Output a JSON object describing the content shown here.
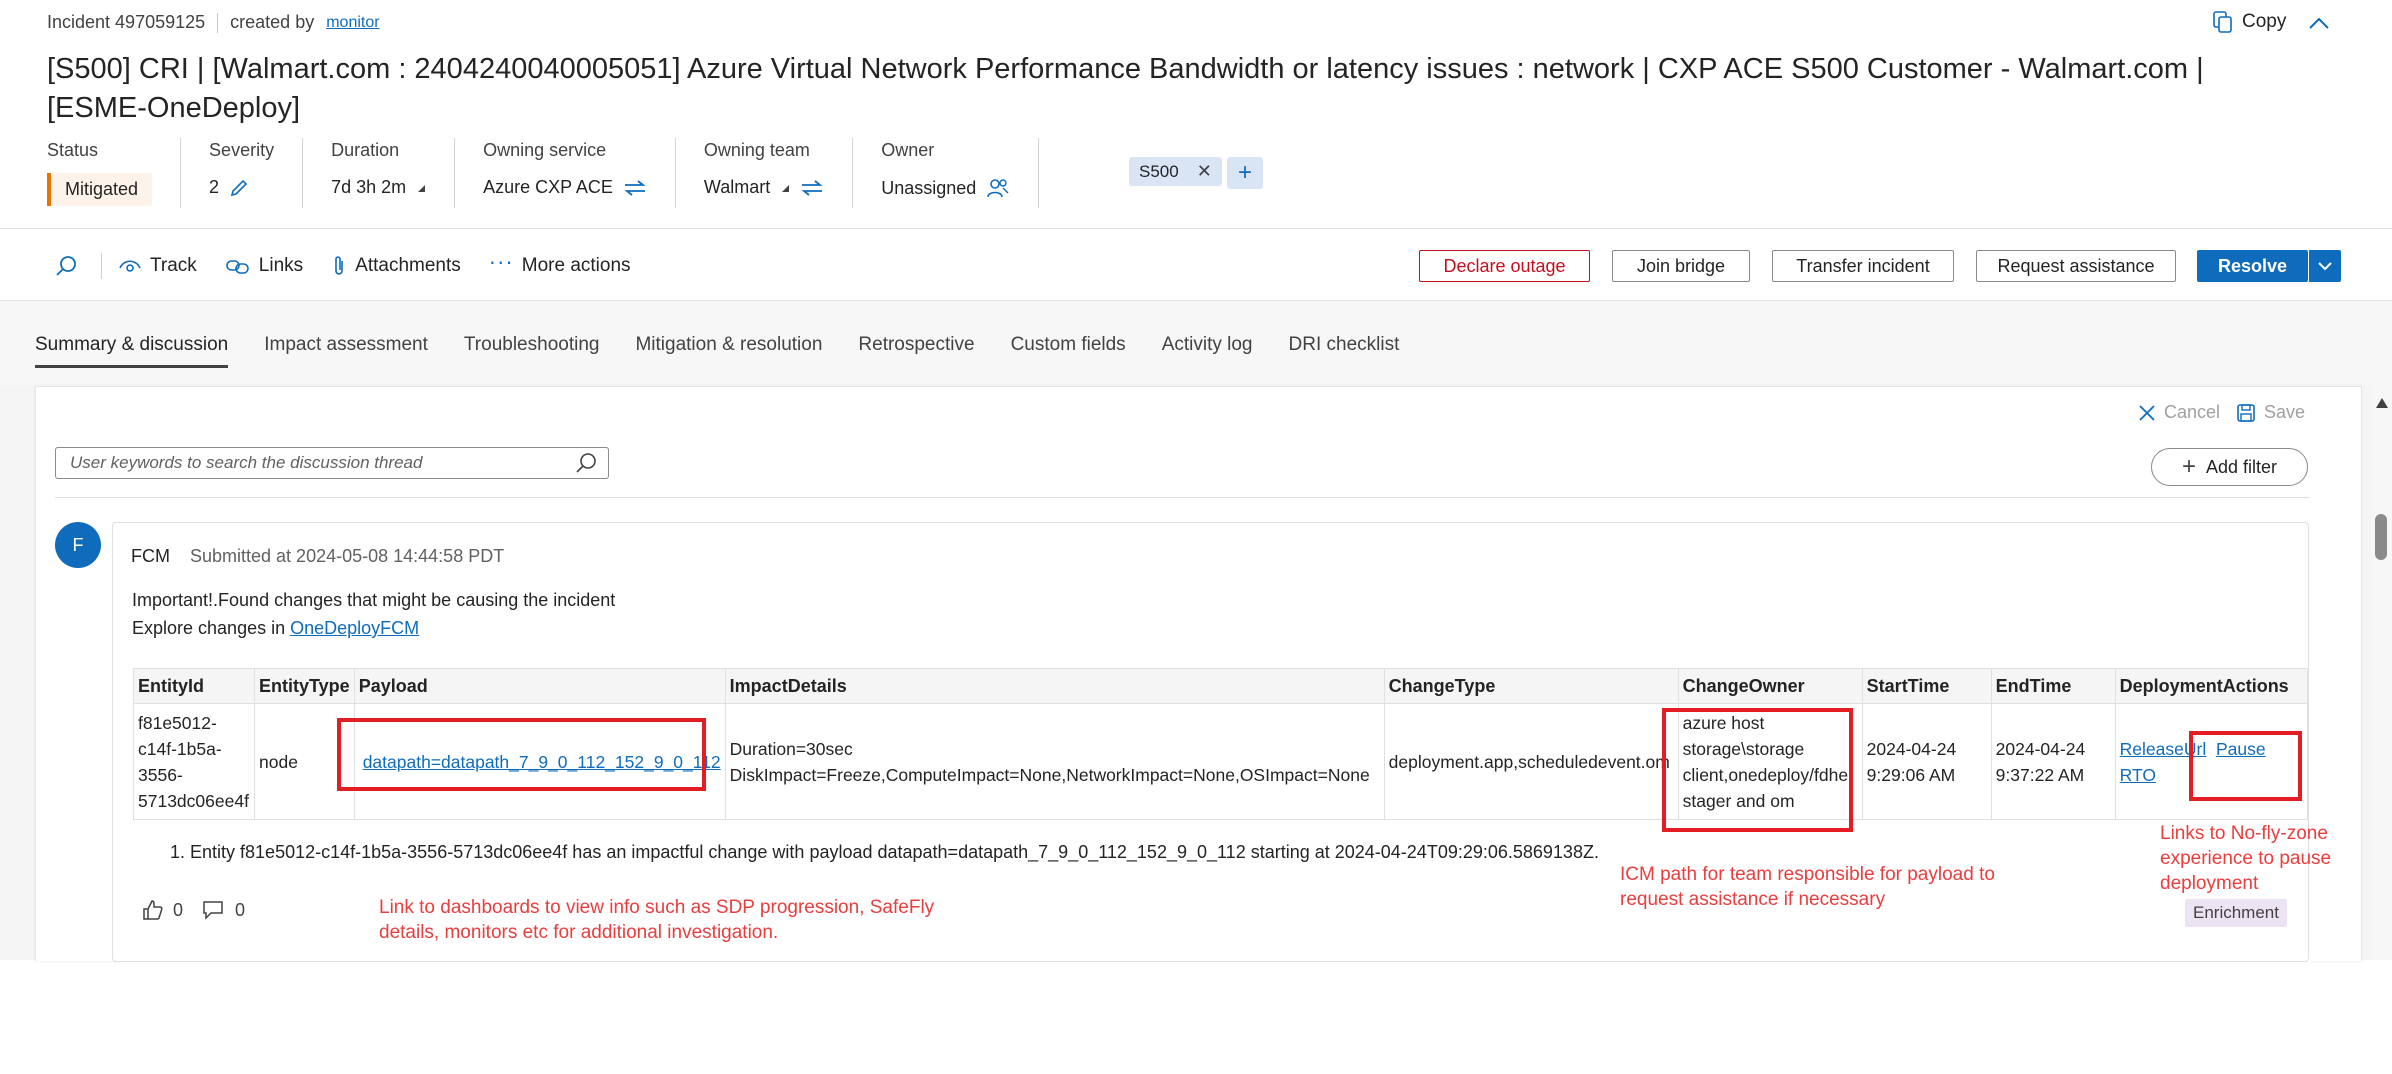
{
  "header": {
    "incident_id": "Incident 497059125",
    "created_by_label": "created by",
    "creator": "monitor",
    "copy_label": "Copy",
    "title": "[S500] CRI | [Walmart.com : 2404240040005051] Azure Virtual Network Performance Bandwidth or latency issues : network | CXP ACE S500 Customer - Walmart.com | [ESME-OneDeploy]"
  },
  "properties": {
    "status_label": "Status",
    "status_value": "Mitigated",
    "severity_label": "Severity",
    "severity_value": "2",
    "duration_label": "Duration",
    "duration_value": "7d 3h 2m",
    "service_label": "Owning service",
    "service_value": "Azure CXP ACE",
    "team_label": "Owning team",
    "team_value": "Walmart",
    "owner_label": "Owner",
    "owner_value": "Unassigned",
    "tag": "S500"
  },
  "toolbar": {
    "track": "Track",
    "links": "Links",
    "attachments": "Attachments",
    "more": "More actions",
    "declare_outage": "Declare outage",
    "join_bridge": "Join bridge",
    "transfer": "Transfer incident",
    "request_assistance": "Request assistance",
    "resolve": "Resolve"
  },
  "tabs": [
    "Summary & discussion",
    "Impact assessment",
    "Troubleshooting",
    "Mitigation & resolution",
    "Retrospective",
    "Custom fields",
    "Activity log",
    "DRI checklist"
  ],
  "discussion": {
    "cancel": "Cancel",
    "save": "Save",
    "search_placeholder": "User keywords to search the discussion thread",
    "add_filter": "Add filter"
  },
  "post": {
    "avatar_letter": "F",
    "author": "FCM",
    "submitted": "Submitted at 2024-05-08 14:44:58 PDT",
    "line1": "Important!.Found changes that might be causing the incident",
    "line2_prefix": "Explore changes in ",
    "line2_link": "OneDeployFCM",
    "table": {
      "headers": [
        "EntityId",
        "EntityType",
        "Payload",
        "ImpactDetails",
        "ChangeType",
        "ChangeOwner",
        "StartTime",
        "EndTime",
        "DeploymentActions"
      ],
      "row": {
        "entity_id": [
          "f81e5012-",
          "c14f-1b5a-",
          "3556-",
          "5713dc06ee4f"
        ],
        "entity_type": "node",
        "payload": "datapath=datapath_7_9_0_112_152_9_0_112",
        "impact_line1": "Duration=30sec",
        "impact_line2": "DiskImpact=Freeze,ComputeImpact=None,NetworkImpact=None,OSImpact=None",
        "change_type": "deployment.app,scheduledevent.om",
        "change_owner": [
          "azure host",
          "storage\\storage",
          "client,onedeploy/fdhe,",
          "stager and om"
        ],
        "start_time": [
          "2024-04-24",
          "9:29:06 AM"
        ],
        "end_time": [
          "2024-04-24",
          "9:37:22 AM"
        ],
        "release_url": "ReleaseUrl",
        "pause_rto": "Pause RTO"
      }
    },
    "note": "1. Entity f81e5012-c14f-1b5a-3556-5713dc06ee4f has an impactful change with payload datapath=datapath_7_9_0_112_152_9_0_112 starting at 2024-04-24T09:29:06.5869138Z.",
    "likes": "0",
    "dislikes": "0",
    "enrichment": "Enrichment"
  },
  "annotations": {
    "dashboards": [
      "Link to dashboards to view info such as SDP progression, SafeFly",
      "details, monitors etc for additional investigation."
    ],
    "icm_path": [
      "ICM path for team responsible for payload to",
      "request assistance if necessary"
    ],
    "no_fly": [
      "Links to No-fly-zone",
      "experience to pause",
      "deployment"
    ]
  },
  "colors": {
    "accent": "#0f6cbd",
    "status": "#e97300",
    "annotation": "#e41c23"
  }
}
